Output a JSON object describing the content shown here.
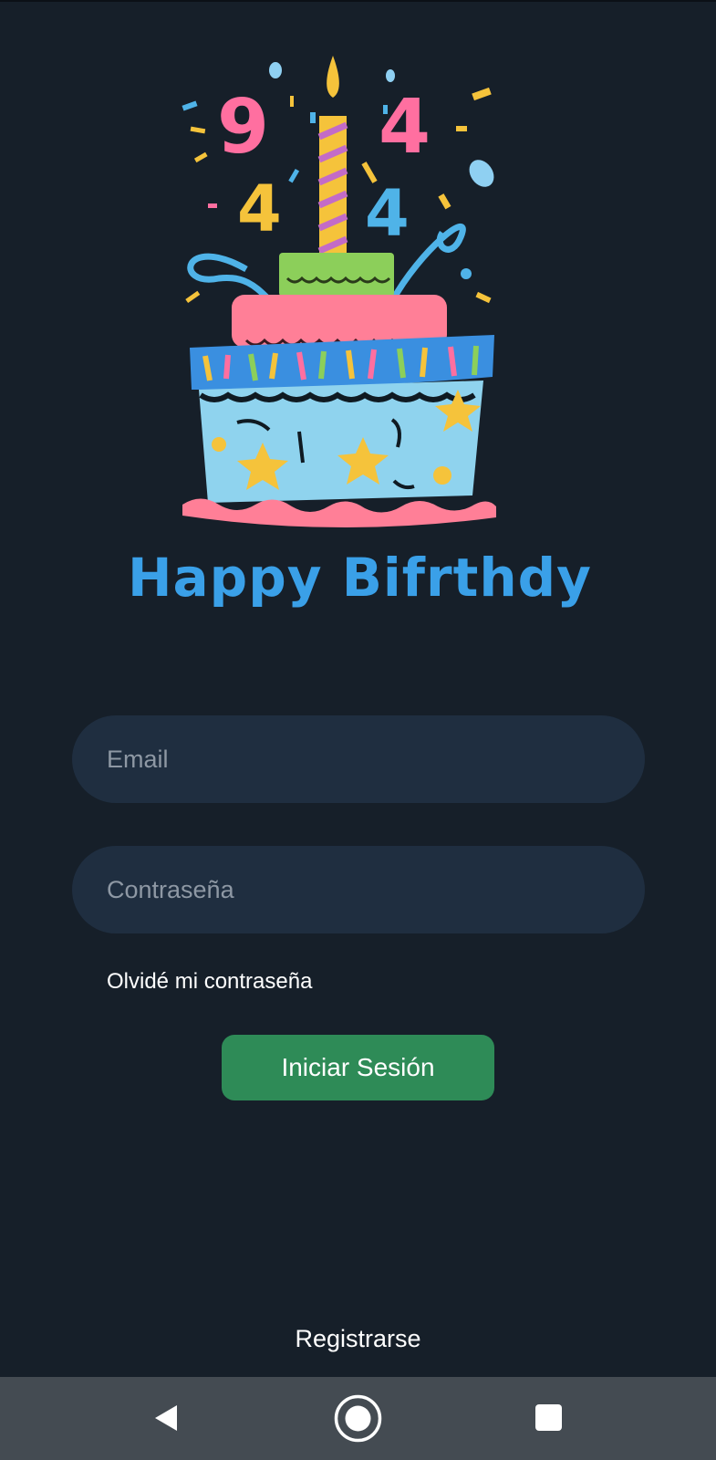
{
  "illustration": {
    "name": "birthday-cake-illustration",
    "caption_text": "Happy Bifrthdy",
    "decorations": [
      "9",
      "4",
      "4",
      "4"
    ]
  },
  "login_form": {
    "email_placeholder": "Email",
    "password_placeholder": "Contraseña",
    "forgot_password_label": "Olvidé mi contraseña",
    "submit_label": "Iniciar Sesión"
  },
  "footer": {
    "register_label": "Registrarse"
  },
  "navbar": {
    "icons": [
      "back-icon",
      "home-icon",
      "recents-icon"
    ]
  },
  "colors": {
    "background": "#161f29",
    "input_background": "#1f2e40",
    "primary_button": "#2e8b57",
    "navbar": "#444b52"
  }
}
